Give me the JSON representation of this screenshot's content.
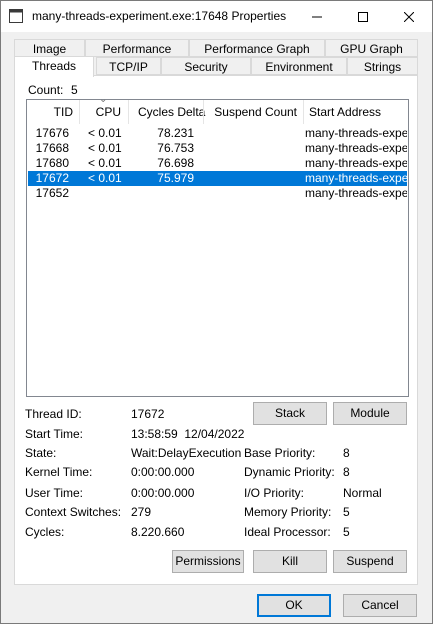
{
  "window": {
    "title": "many-threads-experiment.exe:17648 Properties",
    "minimize_glyph": "—",
    "maximize_glyph": "☐",
    "close_glyph": "✕"
  },
  "tabs_top": [
    {
      "label": "Image"
    },
    {
      "label": "Performance"
    },
    {
      "label": "Performance Graph"
    },
    {
      "label": "GPU Graph"
    }
  ],
  "tabs_bottom": [
    {
      "label": "Threads"
    },
    {
      "label": "TCP/IP"
    },
    {
      "label": "Security"
    },
    {
      "label": "Environment"
    },
    {
      "label": "Strings"
    }
  ],
  "count": {
    "label": "Count:",
    "value": "5"
  },
  "table": {
    "columns": [
      "TID",
      "CPU",
      "Cycles Delta",
      "Suspend Count",
      "Start Address"
    ],
    "sort_indicator": "⌄",
    "rows": [
      {
        "tid": "17676",
        "cpu": "< 0.01",
        "cycles": "78.231",
        "suspend": "",
        "address": "many-threads-expe..."
      },
      {
        "tid": "17668",
        "cpu": "< 0.01",
        "cycles": "76.753",
        "suspend": "",
        "address": "many-threads-expe..."
      },
      {
        "tid": "17680",
        "cpu": "< 0.01",
        "cycles": "76.698",
        "suspend": "",
        "address": "many-threads-expe..."
      },
      {
        "tid": "17672",
        "cpu": "< 0.01",
        "cycles": "75.979",
        "suspend": "",
        "address": "many-threads-expe..."
      },
      {
        "tid": "17652",
        "cpu": "",
        "cycles": "",
        "suspend": "",
        "address": "many-threads-expe..."
      }
    ],
    "selected_index": 3
  },
  "details": {
    "thread_id_label": "Thread ID:",
    "thread_id": "17672",
    "start_time_label": "Start Time:",
    "start_time": "13:58:59  12/04/2022",
    "state_label": "State:",
    "state": "Wait:DelayExecution",
    "kernel_time_label": "Kernel Time:",
    "kernel_time": "0:00:00.000",
    "user_time_label": "User Time:",
    "user_time": "0:00:00.000",
    "context_switches_label": "Context Switches:",
    "context_switches": "279",
    "cycles_label": "Cycles:",
    "cycles": "8.220.660",
    "base_priority_label": "Base Priority:",
    "base_priority": "8",
    "dynamic_priority_label": "Dynamic Priority:",
    "dynamic_priority": "8",
    "io_priority_label": "I/O Priority:",
    "io_priority": "Normal",
    "memory_priority_label": "Memory Priority:",
    "memory_priority": "5",
    "ideal_processor_label": "Ideal Processor:",
    "ideal_processor": "5"
  },
  "buttons": {
    "stack": "Stack",
    "module": "Module",
    "permissions": "Permissions",
    "kill": "Kill",
    "suspend": "Suspend",
    "ok": "OK",
    "cancel": "Cancel"
  },
  "colors": {
    "selection": "#0078d7",
    "button_face": "#e1e1e1",
    "dialog_bg": "#f0f0f0"
  }
}
